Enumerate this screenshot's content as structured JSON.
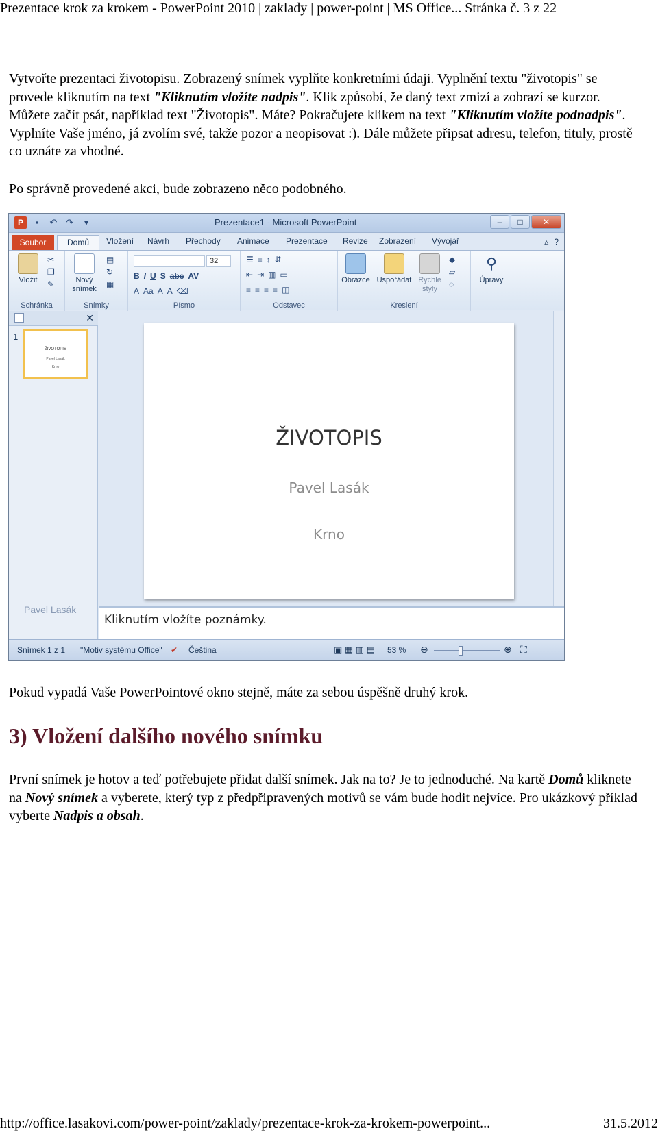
{
  "header": {
    "title": "Prezentace krok za krokem - PowerPoint 2010 | zaklady | power-point | MS Office... Stránka č. 3 z 22"
  },
  "intro": {
    "s1": "Vytvořte prezentaci životopisu. Zobrazený snímek vyplňte konkretními údaji. Vyplnění textu \"životopis\" se provede kliknutím na text ",
    "s1_em": "\"Kliknutím vložíte nadpis\"",
    "s2": ". Klik způsobí, že daný text zmizí a zobrazí se kurzor. Můžete začít psát, například text \"Životopis\". Máte? Pokračujete klikem na text ",
    "s2_em": "\"Kliknutím vložíte podnadpis\"",
    "s3": ". Vyplníte Vaše jméno, já zvolím své, takže pozor a neopisovat :). Dále můžete připsat adresu, telefon, tituly, prostě co uznáte za vhodné."
  },
  "after_action": "Po správně provedené akci, bude zobrazeno něco podobného.",
  "screenshot": {
    "window_title": "Prezentace1 - Microsoft PowerPoint",
    "app_logo": "P",
    "tabs": [
      "Soubor",
      "Domů",
      "Vložení",
      "Návrh",
      "Přechody",
      "Animace",
      "Prezentace",
      "Revize",
      "Zobrazení",
      "Vývojář"
    ],
    "ribbon": {
      "paste": "Vložit",
      "new_slide_1": "Nový",
      "new_slide_2": "snímek",
      "font_size": "32",
      "shapes": "Obrazce",
      "arrange": "Uspořádat",
      "quick_styles_1": "Rychlé",
      "quick_styles_2": "styly",
      "editing": "Úpravy",
      "groups": [
        "Schránka",
        "Snímky",
        "Písmo",
        "Odstavec",
        "Kreslení"
      ]
    },
    "thumb_number": "1",
    "thumb_title": "ŽIVOTOPIS",
    "thumb_sub1": "Pavel Lasák",
    "thumb_sub2": "Krno",
    "slide": {
      "title": "ŽIVOTOPIS",
      "sub1": "Pavel Lasák",
      "sub2": "Krno"
    },
    "pane_name": "Pavel Lasák",
    "notes_placeholder": "Kliknutím vložíte poznámky.",
    "status": {
      "slide_count": "Snímek 1 z 1",
      "theme": "\"Motiv systému Office\"",
      "language": "Čeština",
      "zoom": "53 %",
      "zoom_level_percent": 53
    }
  },
  "result_text": "Pokud vypadá Vaše PowerPointové okno stejně, máte za sebou úspěšně druhý krok.",
  "section3": {
    "heading": "3) Vložení dalšího nového snímku",
    "t1": "První snímek je hotov a teď potřebujete přidat další snímek. Jak na to? Je to jednoduché. Na kartě ",
    "b1": "Domů",
    "t2": " kliknete na ",
    "b2": "Nový snímek",
    "t3": " a vyberete, který typ z předpřipravených motivů se vám bude hodit nejvíce. Pro ukázkový příklad vyberte ",
    "b3": "Nadpis a obsah",
    "t4": "."
  },
  "footer": {
    "url": "http://office.lasakovi.com/power-point/zaklady/prezentace-krok-za-krokem-powerpoint...",
    "date": "31.5.2012"
  },
  "colors": {
    "heading": "#5b1b2a",
    "file_tab": "#d24726"
  }
}
